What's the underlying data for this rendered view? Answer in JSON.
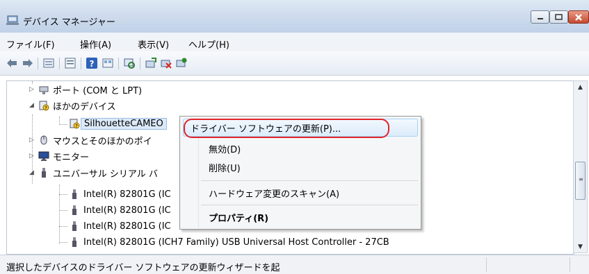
{
  "window": {
    "title": "デバイス マネージャー"
  },
  "menu": [
    "ファイル(F)",
    "操作(A)",
    "表示(V)",
    "ヘルプ(H)"
  ],
  "toolbar": [
    "back-icon",
    "forward-icon",
    "properties-view-icon",
    "device-list-icon",
    "help-icon",
    "resource-view-icon",
    "scan-hardware-icon",
    "update-driver-icon",
    "disable-device-icon",
    "uninstall-device-icon"
  ],
  "tree": {
    "ports": "ポート (COM と LPT)",
    "other_devices": "ほかのデバイス",
    "silhouette": "SilhouetteCAMEO",
    "mice": "マウスとそのほかのポイ",
    "monitors": "モニター",
    "usb": "ユニバーサル シリアル バ",
    "usb_children": [
      "Intel(R) 82801G (IC",
      "Intel(R) 82801G (IC",
      "Intel(R) 82801G (IC",
      "Intel(R) 82801G (ICH7 Family) USB Universal Host Controller - 27CB"
    ]
  },
  "context_menu": {
    "update_driver": "ドライバー ソフトウェアの更新(P)...",
    "disable": "無効(D)",
    "uninstall": "削除(U)",
    "scan": "ハードウェア変更のスキャン(A)",
    "properties": "プロパティ(R)"
  },
  "status": {
    "text": "選択したデバイスのドライバー ソフトウェアの更新ウィザードを起"
  },
  "colors": {
    "highlight_oval": "#e2232a",
    "selection": "#dbe9f8"
  }
}
